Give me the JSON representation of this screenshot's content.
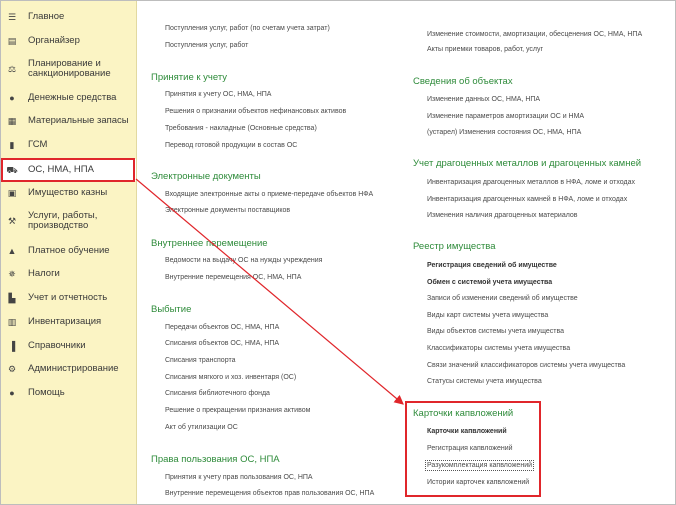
{
  "sidebar": {
    "items": [
      {
        "label": "Главное",
        "icon": "menu-icon"
      },
      {
        "label": "Органайзер",
        "icon": "organizer-icon"
      },
      {
        "label": "Планирование и\nсанкционирование",
        "icon": "planning-icon"
      },
      {
        "label": "Денежные средства",
        "icon": "money-icon"
      },
      {
        "label": "Материальные запасы",
        "icon": "grid-icon"
      },
      {
        "label": "ГСМ",
        "icon": "fuel-icon"
      },
      {
        "label": "ОС, НМА, НПА",
        "icon": "truck-icon"
      },
      {
        "label": "Имущество казны",
        "icon": "treasury-icon"
      },
      {
        "label": "Услуги, работы,\nпроизводство",
        "icon": "tools-icon"
      },
      {
        "label": "Платное обучение",
        "icon": "graduation-icon"
      },
      {
        "label": "Налоги",
        "icon": "emblem-icon"
      },
      {
        "label": "Учет и отчетность",
        "icon": "chart-icon"
      },
      {
        "label": "Инвентаризация",
        "icon": "clipboard-icon"
      },
      {
        "label": "Справочники",
        "icon": "books-icon"
      },
      {
        "label": "Администрирование",
        "icon": "gear-icon"
      },
      {
        "label": "Помощь",
        "icon": "help-icon"
      }
    ]
  },
  "col1": {
    "top_links": [
      "Поступления услуг, работ (по счетам учета затрат)",
      "Поступления услуг, работ"
    ],
    "sections": [
      {
        "title": "Принятие к учету",
        "links": [
          "Принятия к учету ОС, НМА, НПА",
          "Решения о признании объектов нефинансовых активов",
          "Требования - накладные (Основные средства)",
          "Перевод готовой продукции в состав ОС"
        ]
      },
      {
        "title": "Электронные документы",
        "links": [
          "Входящие электронные акты о приеме-передаче объектов НФА",
          "Электронные документы поставщиков"
        ]
      },
      {
        "title": "Внутреннее перемещение",
        "links": [
          "Ведомости на выдачу ОС на нужды учреждения",
          "Внутренние перемещения ОС, НМА, НПА"
        ]
      },
      {
        "title": "Выбытие",
        "links": [
          "Передачи объектов ОС, НМА, НПА",
          "Списания объектов ОС, НМА, НПА",
          "Списания транспорта",
          "Списания мягкого и хоз. инвентаря (ОС)",
          "Списания библиотечного фонда",
          "Решение о прекращении признания активом",
          "Акт об утилизации ОС"
        ]
      },
      {
        "title": "Права пользования ОС, НПА",
        "links": [
          "Принятия к учету прав пользования ОС, НПА",
          "Внутренние перемещения объектов прав пользования ОС, НПА"
        ]
      }
    ]
  },
  "col2": {
    "top_links": [
      "Изменение стоимости, амортизации, обесценения ОС, НМА, НПА",
      "Акты приемки товаров, работ, услуг"
    ],
    "sections": [
      {
        "title": "Сведения об объектах",
        "links": [
          "Изменение данных ОС, НМА, НПА",
          "Изменение параметров амортизации ОС и НМА",
          "(устарел) Изменения состояния ОС, НМА, НПА"
        ]
      },
      {
        "title": "Учет драгоценных металлов и драгоценных камней",
        "links": [
          "Инвентаризация драгоценных металлов в НФА, ломе и отходах",
          "Инвентаризация драгоценных камней в НФА, ломе и отходах",
          "Изменения наличия драгоценных материалов"
        ]
      },
      {
        "title": "Реестр имущества",
        "links": [
          "Регистрация сведений об имуществе",
          "Обмен с системой учета имущества",
          "Записи об изменении сведений об имуществе",
          "Виды карт системы учета имущества",
          "Виды объектов системы учета имущества",
          "Классификаторы системы учета имущества",
          "Связи значений классификаторов системы учета имущества",
          "Статусы системы учета имущества"
        ]
      },
      {
        "title": "Карточки капвложений",
        "links": [
          "Карточки капвложений",
          "Регистрация капвложений",
          "Разукомплектация капвложений",
          "Истории карточек капвложений"
        ]
      }
    ]
  },
  "colors": {
    "sidebar_bg": "#fbf4c4",
    "heading": "#2e8b3a",
    "highlight": "#e0262b"
  }
}
